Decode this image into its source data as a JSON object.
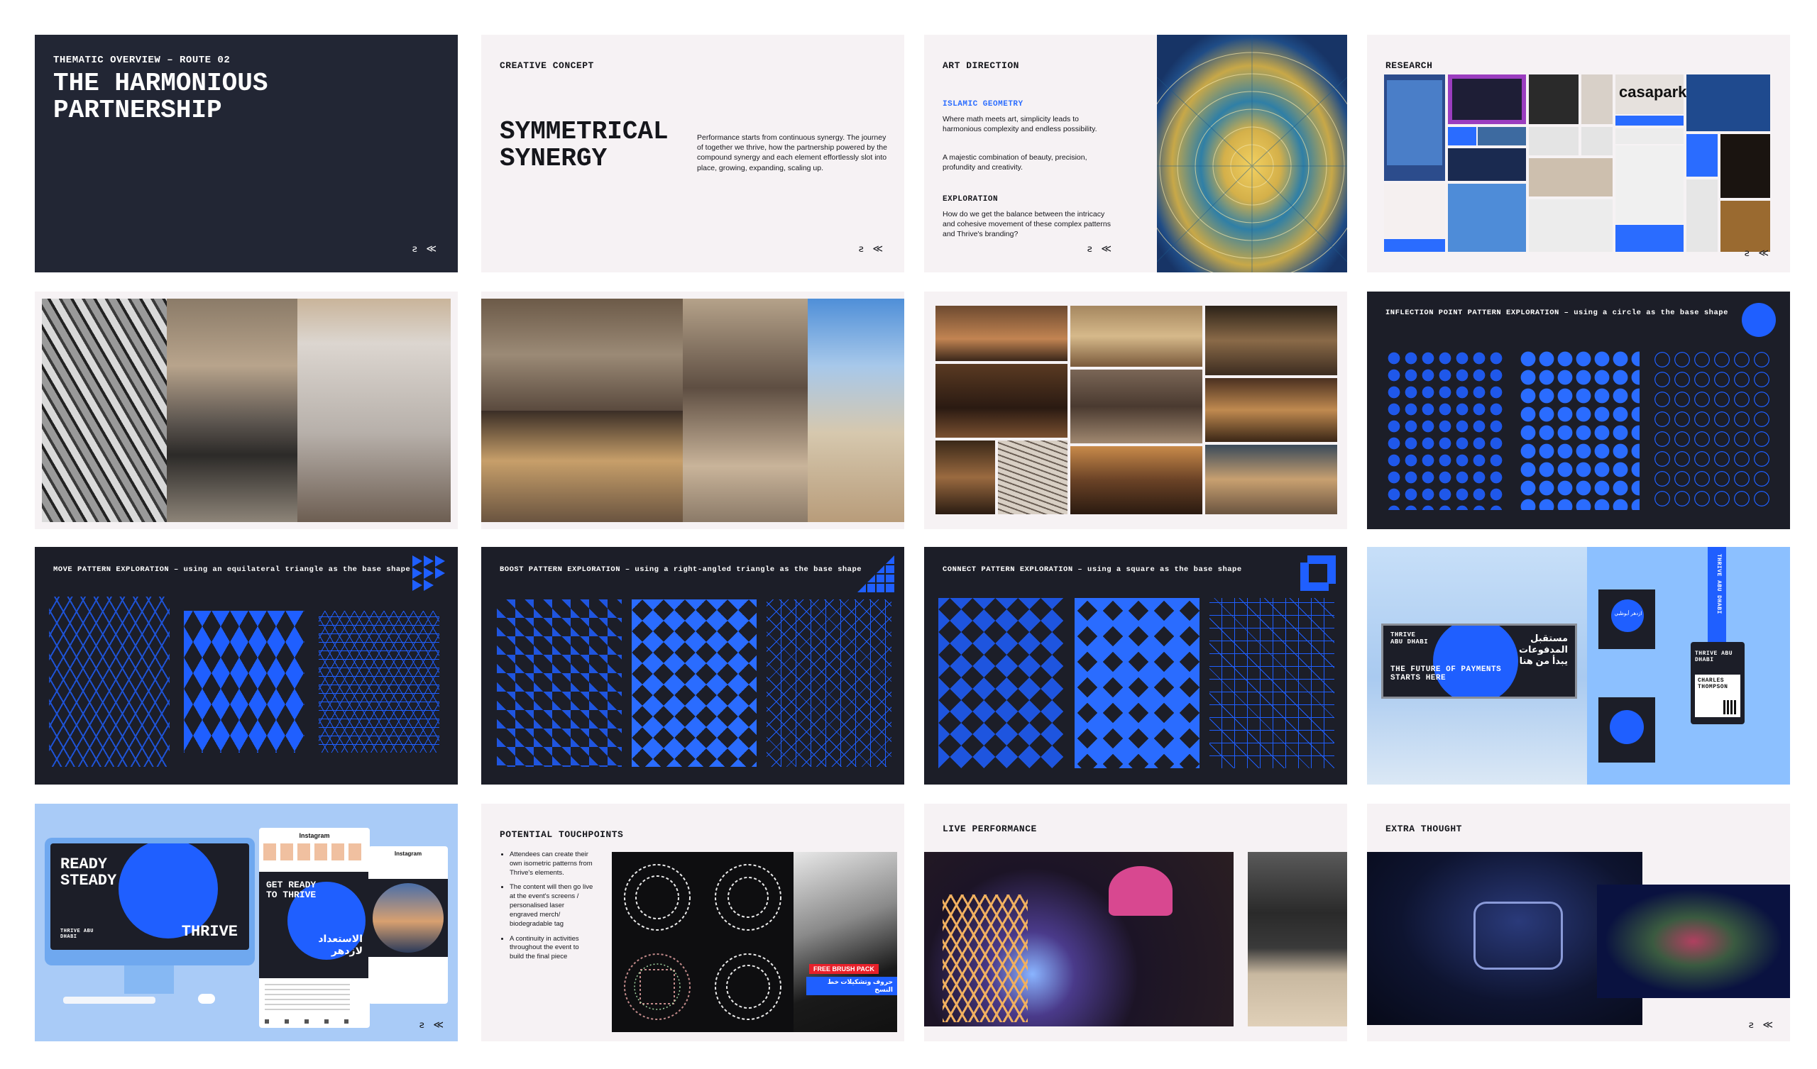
{
  "slides": {
    "s1": {
      "kicker": "THEMATIC OVERVIEW – ROUTE 02",
      "title_l1": "THE HARMONIOUS",
      "title_l2": "PARTNERSHIP",
      "logo": "ꙅ ≪"
    },
    "s2": {
      "kicker": "CREATIVE CONCEPT",
      "title_l1": "SYMMETRICAL",
      "title_l2": "SYNERGY",
      "body": "Performance starts from continuous synergy. The journey of together we thrive, how the partnership powered by the compound synergy and each element effortlessly slot into place, growing, expanding, scaling up.",
      "logo": "ꙅ ≪"
    },
    "s3": {
      "kicker": "ART DIRECTION",
      "sub1": "ISLAMIC GEOMETRY",
      "p1": "Where math meets art, simplicity leads to harmonious complexity and endless possibility.",
      "p2": "A majestic combination of beauty, precision, profundity and creativity.",
      "sub2": "EXPLORATION",
      "p3": "How do we get the balance between the intricacy and cohesive movement of these complex patterns and Thrive's branding?",
      "logo": "ꙅ ≪"
    },
    "s4": {
      "kicker": "RESEARCH",
      "casapark": "casapark",
      "logo": "ꙅ ≪"
    },
    "s8": {
      "kicker": "INFLECTION POINT PATTERN EXPLORATION – using a circle as the base shape"
    },
    "s9": {
      "kicker": "MOVE PATTERN EXPLORATION – using an equilateral triangle as the base shape"
    },
    "s10": {
      "kicker": "BOOST PATTERN EXPLORATION – using a right-angled triangle as the base shape"
    },
    "s11": {
      "kicker": "CONNECT PATTERN EXPLORATION – using a square as the base shape"
    },
    "s12": {
      "banner_brand": "THRIVE ABU DHABI",
      "banner_ar": "مستقبل المدفوعات يبدأ من هنا",
      "banner_en": "THE FUTURE OF PAYMENTS STARTS HERE",
      "lanyard": "THRIVE ABU DHABI",
      "badge_brand": "THRIVE ABU DHABI",
      "badge_name": "CHARLES THOMPSON",
      "tote_ar": "ازدهر أبوظبي"
    },
    "s13": {
      "screen_l1": "READY",
      "screen_l2": "STEADY",
      "screen_thrive": "THRIVE",
      "screen_small": "THRIVE ABU DHABI",
      "ig1": "Instagram",
      "ig2": "Instagram",
      "post_l1": "GET READY",
      "post_l2": "TO THRIVE",
      "post_ar": "الاستعداد لازدهر",
      "logo": "ꙅ ≪"
    },
    "s14": {
      "kicker": "POTENTIAL TOUCHPOINTS",
      "bullets": [
        "Attendees can create their own isometric patterns from Thrive's elements.",
        "The content will then go live at the event's screens / personalised laser engraved merch/ biodegradable tag",
        "A continuity in activities throughout the event to build the final piece"
      ],
      "brush_en": "FREE BRUSH PACK",
      "brush_ar": "حروف وتشكيلات خط النسخ"
    },
    "s15": {
      "kicker": "LIVE PERFORMANCE"
    },
    "s16": {
      "kicker": "EXTRA THOUGHT",
      "logo": "ꙅ ≪"
    }
  },
  "colors": {
    "accent": "#1f5fff",
    "dark": "#1c1e28",
    "navy": "#222634",
    "light": "#f6f2f4",
    "sky": "#8cc0ff"
  }
}
